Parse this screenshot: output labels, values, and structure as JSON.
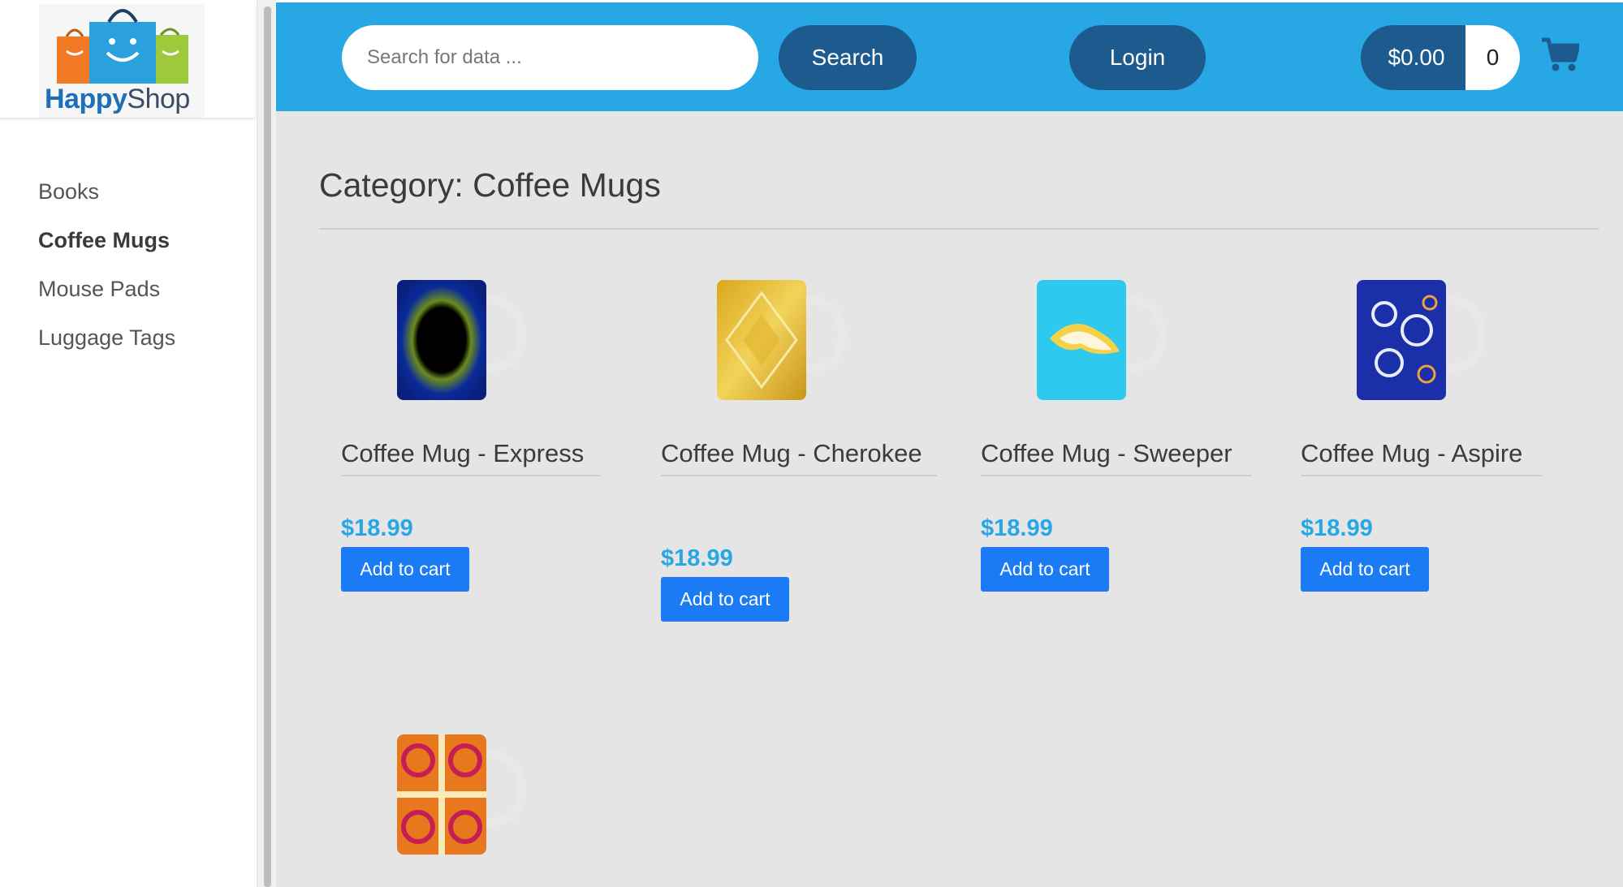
{
  "logo": {
    "word1": "Happy",
    "word2": "Shop"
  },
  "sidebar": {
    "items": [
      {
        "label": "Books"
      },
      {
        "label": "Coffee Mugs"
      },
      {
        "label": "Mouse Pads"
      },
      {
        "label": "Luggage Tags"
      }
    ]
  },
  "header": {
    "search_placeholder": "Search for data ...",
    "search_label": "Search",
    "login_label": "Login",
    "cart_total": "$0.00",
    "cart_count": "0"
  },
  "main": {
    "title": "Category: Coffee Mugs",
    "products": [
      {
        "name": "Coffee Mug - Express",
        "price": "$18.99",
        "button": "Add to cart",
        "pattern": "dark-blue-fractal"
      },
      {
        "name": "Coffee Mug - Cherokee",
        "price": "$18.99",
        "button": "Add to cart",
        "pattern": "golden-diamond"
      },
      {
        "name": "Coffee Mug - Sweeper",
        "price": "$18.99",
        "button": "Add to cart",
        "pattern": "cyan-swirl"
      },
      {
        "name": "Coffee Mug - Aspire",
        "price": "$18.99",
        "button": "Add to cart",
        "pattern": "blue-white-lattice"
      },
      {
        "pattern": "orange-red-spiral"
      }
    ]
  },
  "colors": {
    "header_bg": "#27a8e5",
    "pill_bg": "#1d5b8e",
    "add_button": "#1a7bf5",
    "price": "#27a8e5",
    "content_bg": "#e5e5e5"
  },
  "icons": [
    "shopping-bags-logo",
    "shopping-cart-icon"
  ]
}
